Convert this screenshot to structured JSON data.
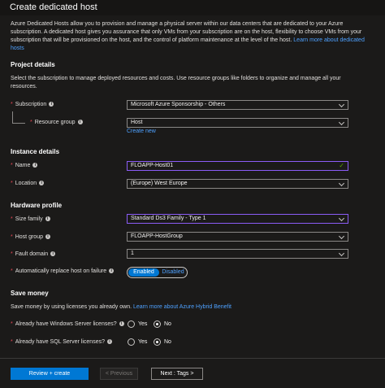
{
  "title": "Create dedicated host",
  "intro": {
    "text": "Azure Dedicated Hosts allow you to provision and manage a physical server within our data centers that are dedicated to your Azure subscription. A dedicated host gives you assurance that only VMs from your subscription are on the host, flexibility to choose VMs from your subscription that will be provisioned on the host, and the control of platform maintenance at the level of the host.",
    "link": "Learn more about dedicated hosts"
  },
  "project": {
    "heading": "Project details",
    "desc": "Select the subscription to manage deployed resources and costs. Use resource groups like folders to organize and manage all your resources.",
    "subscription_label": "Subscription",
    "subscription_value": "Microsoft Azure Sponsorship - Others",
    "resource_group_label": "Resource group",
    "resource_group_value": "Host",
    "create_new": "Create new"
  },
  "instance": {
    "heading": "Instance details",
    "name_label": "Name",
    "name_value": "FLOAPP-Host01",
    "location_label": "Location",
    "location_value": "(Europe) West Europe"
  },
  "hardware": {
    "heading": "Hardware profile",
    "size_label": "Size family",
    "size_value": "Standard Ds3 Family - Type 1",
    "host_group_label": "Host group",
    "host_group_value": "FLOAPP-HostGroup",
    "fault_label": "Fault domain",
    "fault_value": "1",
    "auto_replace_label": "Automatically replace host on failure",
    "toggle_on": "Enabled",
    "toggle_off": "Disabled",
    "toggle_selected": "Enabled"
  },
  "save": {
    "heading": "Save money",
    "desc": "Save money by using licenses you already own.",
    "link": "Learn more about Azure Hybrid Benefit",
    "windows_label": "Already have Windows Server licenses?",
    "sql_label": "Already have SQL Server licenses?",
    "yes": "Yes",
    "no": "No",
    "windows_selected": "No",
    "sql_selected": "No"
  },
  "footer": {
    "review": "Review + create",
    "previous": "< Previous",
    "next": "Next : Tags >"
  },
  "colors": {
    "background": "#1b1a19",
    "accent": "#0078d4",
    "link": "#4ea1ff",
    "required": "#e74856",
    "focus_border": "#8b5cf6"
  }
}
